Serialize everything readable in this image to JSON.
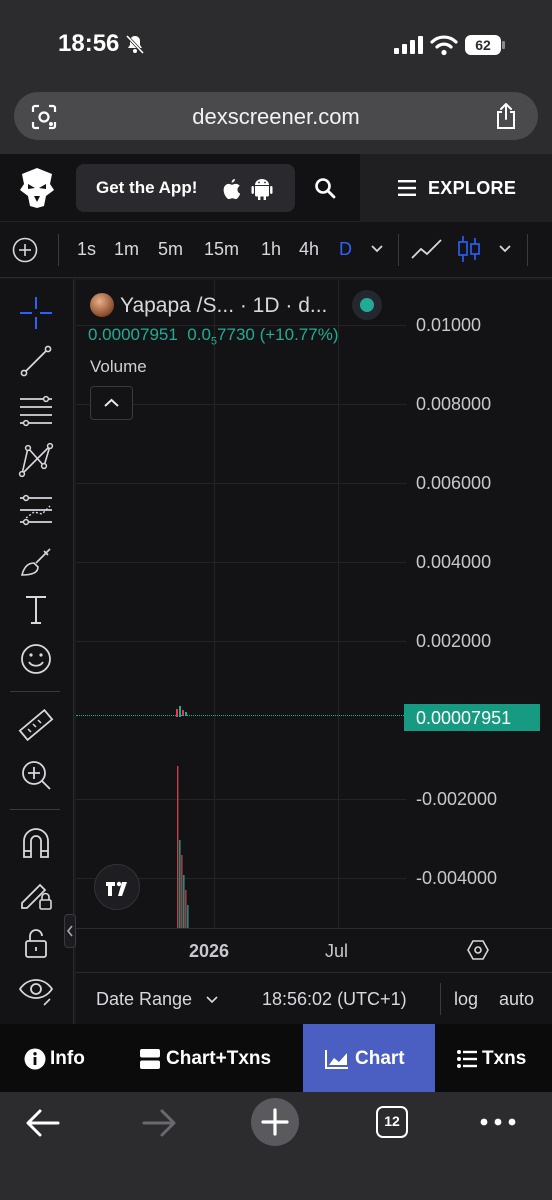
{
  "status": {
    "time": "18:56",
    "battery": "62"
  },
  "browser": {
    "url": "dexscreener.com",
    "tab_count": "12"
  },
  "site_header": {
    "get_app_label": "Get the App!",
    "explore_label": "EXPLORE"
  },
  "toolbar": {
    "intervals": [
      "1s",
      "1m",
      "5m",
      "15m",
      "1h",
      "4h",
      "D"
    ],
    "active_interval": "D"
  },
  "chart": {
    "legend_title": "Yapapa /S... · 1D · d...",
    "legend_price": "0.00007951",
    "legend_change_prefix": "0.0",
    "legend_change_sub": "5",
    "legend_change_rest": "7730 (+10.77%)",
    "volume_label": "Volume",
    "y_ticks": [
      "0.01000",
      "0.008000",
      "0.006000",
      "0.004000",
      "0.002000",
      "-0.002000",
      "-0.004000"
    ],
    "current_price": "0.00007951",
    "x_ticks": [
      "2026",
      "Jul"
    ],
    "up_color": "#22ab94",
    "down_color": "#f23645"
  },
  "date_bar": {
    "date_range": "Date Range",
    "clock": "18:56:02 (UTC+1)",
    "log": "log",
    "auto": "auto"
  },
  "tabs": {
    "info": "Info",
    "chart_txns": "Chart+Txns",
    "chart": "Chart",
    "txns": "Txns",
    "active": "Chart",
    "active_color": "#4a5fc1"
  }
}
